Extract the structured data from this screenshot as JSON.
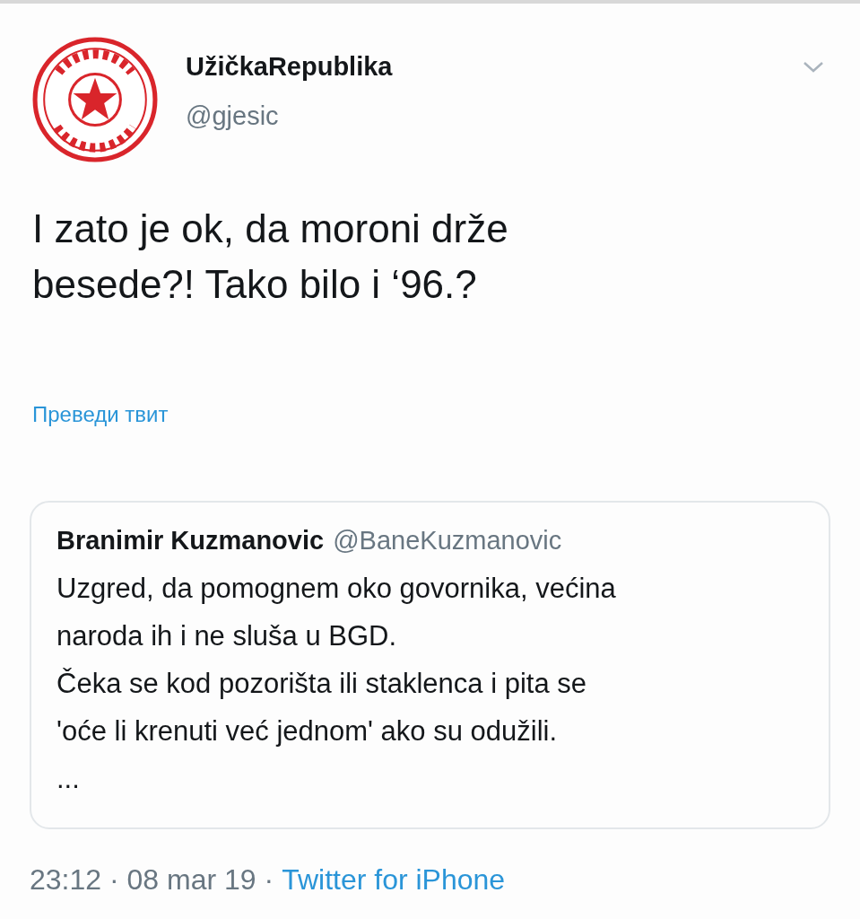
{
  "author": {
    "name": "UžičkaRepublika",
    "handle": "@gjesic"
  },
  "tweet": {
    "lines": [
      "I zato je ok, da moroni drže",
      "besede?! Tako bilo i ‘96.?"
    ]
  },
  "translate_link": "Преведи твит",
  "quoted_tweet": {
    "name": "Branimir Kuzmanovic",
    "handle": "@BaneKuzmanovic",
    "lines": [
      "Uzgred, da pomognem oko govornika, većina",
      "naroda ih i ne sluša u BGD.",
      "Čeka se kod pozorišta ili staklenca i pita se",
      "'oće li krenuti već jednom' ako su odužili.",
      "..."
    ]
  },
  "footer": {
    "timestamp": "23:12 · 08 mar 19 ·",
    "source": "Twitter for iPhone"
  }
}
